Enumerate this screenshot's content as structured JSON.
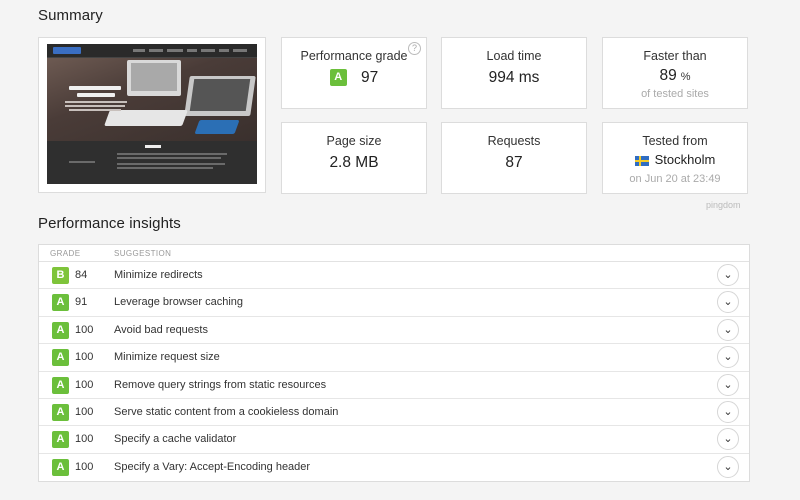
{
  "summary": {
    "title": "Summary",
    "cards": {
      "performance_grade": {
        "label": "Performance grade",
        "grade": "A",
        "value": "97",
        "help_icon": "question-icon"
      },
      "load_time": {
        "label": "Load time",
        "value": "994 ms"
      },
      "faster_than": {
        "label": "Faster than",
        "value": "89",
        "unit": "%",
        "sub": "of tested sites"
      },
      "page_size": {
        "label": "Page size",
        "value": "2.8 MB"
      },
      "requests": {
        "label": "Requests",
        "value": "87"
      },
      "tested_from": {
        "label": "Tested from",
        "location": "Stockholm",
        "flag_icon": "sweden-flag-icon",
        "sub": "on Jun 20 at 23:49"
      }
    },
    "watermark": "pingdom"
  },
  "insights": {
    "title": "Performance insights",
    "columns": {
      "grade": "GRADE",
      "suggestion": "SUGGESTION"
    },
    "rows": [
      {
        "grade": "B",
        "score": "84",
        "suggestion": "Minimize redirects"
      },
      {
        "grade": "A",
        "score": "91",
        "suggestion": "Leverage browser caching"
      },
      {
        "grade": "A",
        "score": "100",
        "suggestion": "Avoid bad requests"
      },
      {
        "grade": "A",
        "score": "100",
        "suggestion": "Minimize request size"
      },
      {
        "grade": "A",
        "score": "100",
        "suggestion": "Remove query strings from static resources"
      },
      {
        "grade": "A",
        "score": "100",
        "suggestion": "Serve static content from a cookieless domain"
      },
      {
        "grade": "A",
        "score": "100",
        "suggestion": "Specify a cache validator"
      },
      {
        "grade": "A",
        "score": "100",
        "suggestion": "Specify a Vary: Accept-Encoding header"
      }
    ],
    "expand_icon": "chevron-down-icon"
  },
  "colors": {
    "grade_a": "#6bbf3b",
    "grade_b": "#7ec43a",
    "background": "#f4f4f4"
  }
}
